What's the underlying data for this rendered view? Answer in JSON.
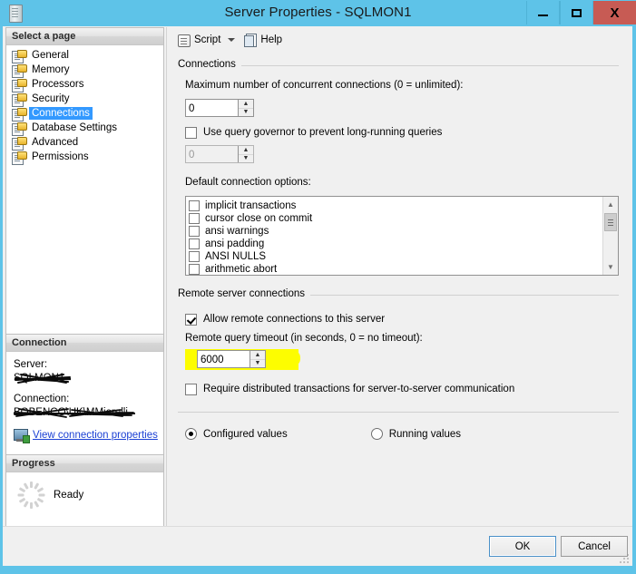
{
  "window": {
    "title": "Server Properties - SQLMON1",
    "title_redacted": true,
    "icon": "server-properties-icon",
    "controls": {
      "minimize": "minimize",
      "maximize": "maximize",
      "close": "X"
    },
    "colors": {
      "titlebar": "#5ec3e8",
      "close_button": "#c75b54",
      "selection": "#3399ff",
      "highlighter": "#fdfd00",
      "link": "#1a3fd4"
    }
  },
  "sidebar": {
    "select_page": {
      "header": "Select a page",
      "items": [
        {
          "label": "General",
          "selected": false
        },
        {
          "label": "Memory",
          "selected": false
        },
        {
          "label": "Processors",
          "selected": false
        },
        {
          "label": "Security",
          "selected": false
        },
        {
          "label": "Connections",
          "selected": true
        },
        {
          "label": "Database Settings",
          "selected": false
        },
        {
          "label": "Advanced",
          "selected": false
        },
        {
          "label": "Permissions",
          "selected": false
        }
      ]
    },
    "connection": {
      "header": "Connection",
      "server_label": "Server:",
      "server_value": "SQLMON1",
      "connection_label": "Connection:",
      "connection_value": "BOBENCO\\UK\\MMiorelli",
      "link_label": "View connection properties",
      "link_icon": "server-connection-icon"
    },
    "progress": {
      "header": "Progress",
      "status": "Ready",
      "icon": "progress-spinner-icon"
    }
  },
  "toolbar": {
    "script_label": "Script",
    "script_icon": "script-icon",
    "dropdown_icon": "chevron-down-icon",
    "help_label": "Help",
    "help_icon": "help-icon"
  },
  "main": {
    "connections_group": {
      "title": "Connections",
      "max_connections_label": "Maximum number of concurrent connections (0 = unlimited):",
      "max_connections_value": "0",
      "query_governor_label": "Use query governor to prevent long-running queries",
      "query_governor_checked": false,
      "query_governor_value": "0",
      "query_governor_disabled": true,
      "default_options_label": "Default connection options:",
      "default_options": [
        {
          "label": "implicit transactions",
          "checked": false
        },
        {
          "label": "cursor close on commit",
          "checked": false
        },
        {
          "label": "ansi warnings",
          "checked": false
        },
        {
          "label": "ansi padding",
          "checked": false
        },
        {
          "label": "ANSI NULLS",
          "checked": false
        },
        {
          "label": "arithmetic abort",
          "checked": false
        }
      ]
    },
    "remote_group": {
      "title": "Remote server connections",
      "allow_remote_label": "Allow remote connections to this server",
      "allow_remote_checked": true,
      "remote_timeout_label": "Remote query timeout (in seconds, 0 = no timeout):",
      "remote_timeout_value": "6000",
      "remote_timeout_highlighted": true,
      "require_dtc_label": "Require distributed transactions for server-to-server communication",
      "require_dtc_checked": false
    },
    "values_mode": {
      "configured_label": "Configured values",
      "configured_selected": true,
      "running_label": "Running values",
      "running_selected": false
    }
  },
  "footer": {
    "ok_label": "OK",
    "cancel_label": "Cancel"
  }
}
